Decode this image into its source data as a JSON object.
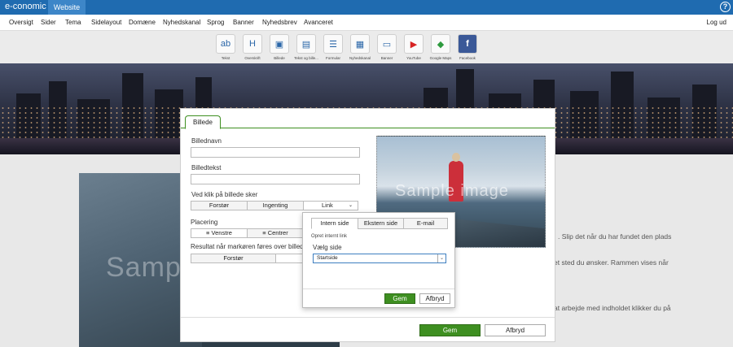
{
  "topbar": {
    "brand": "e-conomic",
    "app_tab": "Website",
    "help_glyph": "?"
  },
  "menu": {
    "items": [
      "Oversigt",
      "Sider",
      "Tema",
      "Sidelayout",
      "Domæne",
      "Nyhedskanal",
      "Sprog",
      "Banner",
      "Nyhedsbrev",
      "Avanceret"
    ],
    "logout": "Log ud"
  },
  "toolbar": {
    "tools": [
      {
        "label": "Tekst",
        "icon": "text-icon",
        "glyph": "ab"
      },
      {
        "label": "Overskrift",
        "icon": "heading-icon",
        "glyph": "H"
      },
      {
        "label": "Billede",
        "icon": "image-icon",
        "glyph": "▣"
      },
      {
        "label": "Tekst og bille...",
        "icon": "text-image-icon",
        "glyph": "▤"
      },
      {
        "label": "Formular",
        "icon": "form-icon",
        "glyph": "☰"
      },
      {
        "label": "Nyhedskanal",
        "icon": "news-icon",
        "glyph": "▦"
      },
      {
        "label": "Banner",
        "icon": "banner-icon",
        "glyph": "▭"
      },
      {
        "label": "YouTube",
        "icon": "youtube-icon",
        "glyph": "▶"
      },
      {
        "label": "Google Maps",
        "icon": "maps-icon",
        "glyph": "◆"
      },
      {
        "label": "Facebook",
        "icon": "facebook-icon",
        "glyph": "f"
      }
    ]
  },
  "background": {
    "sample_text": "Sample",
    "lines": [
      ". Slip det når du har fundet den plads",
      "et sted du ønsker. Rammen vises når",
      "at arbejde med indholdet klikker du på"
    ]
  },
  "modal": {
    "tab": "Billede",
    "name_label": "Billednavn",
    "name_value": "",
    "caption_label": "Billedtekst",
    "caption_value": "",
    "click_label": "Ved klik på billede sker",
    "click_options": [
      "Forstør",
      "Ingenting",
      "Link"
    ],
    "placement_label": "Placering",
    "placement_options": [
      "Venstre",
      "Centrer"
    ],
    "hover_label": "Resultat når markøren føres over billedet",
    "hover_options": [
      "Forstør",
      ""
    ],
    "preview_text": "Sample image",
    "save": "Gem",
    "cancel": "Afbryd"
  },
  "link_popup": {
    "tabs": [
      "Intern side",
      "Ekstern side",
      "E-mail"
    ],
    "heading": "Opret internt link",
    "select_label": "Vælg side",
    "select_value": "Startside",
    "save": "Gem",
    "cancel": "Afbryd"
  },
  "colors": {
    "brand_blue": "#1f6bb0",
    "accent_green": "#3e8f21"
  }
}
